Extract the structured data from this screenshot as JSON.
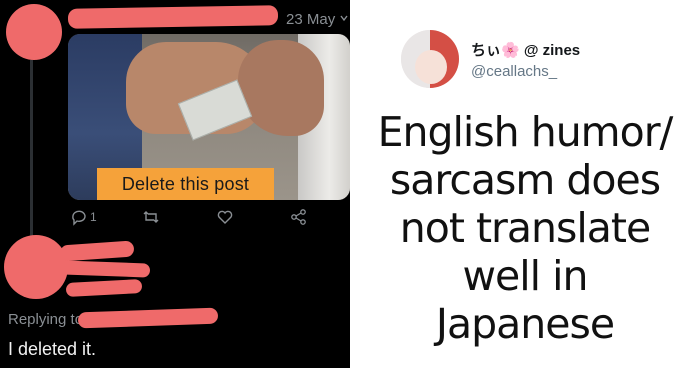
{
  "left_tweet": {
    "date": "23 May",
    "media": {
      "overlay_label": "Delete this post"
    },
    "actions": {
      "reply_count": "1",
      "icons": [
        "reply-icon",
        "retweet-icon",
        "like-icon",
        "share-icon"
      ]
    },
    "reply": {
      "replying_prefix": "Replying to",
      "text": "I deleted it."
    },
    "colors": {
      "background": "#000000",
      "redaction": "#ef6a6a",
      "muted_text": "#8a8f94",
      "label_bg": "#f5a23a"
    }
  },
  "right_tweet": {
    "display_name": "ちぃ🌸 @ zines",
    "handle": "@ceallachs_",
    "text_lines": [
      "English humor/",
      "sarcasm does",
      "not translate",
      "well in",
      "Japanese"
    ]
  }
}
